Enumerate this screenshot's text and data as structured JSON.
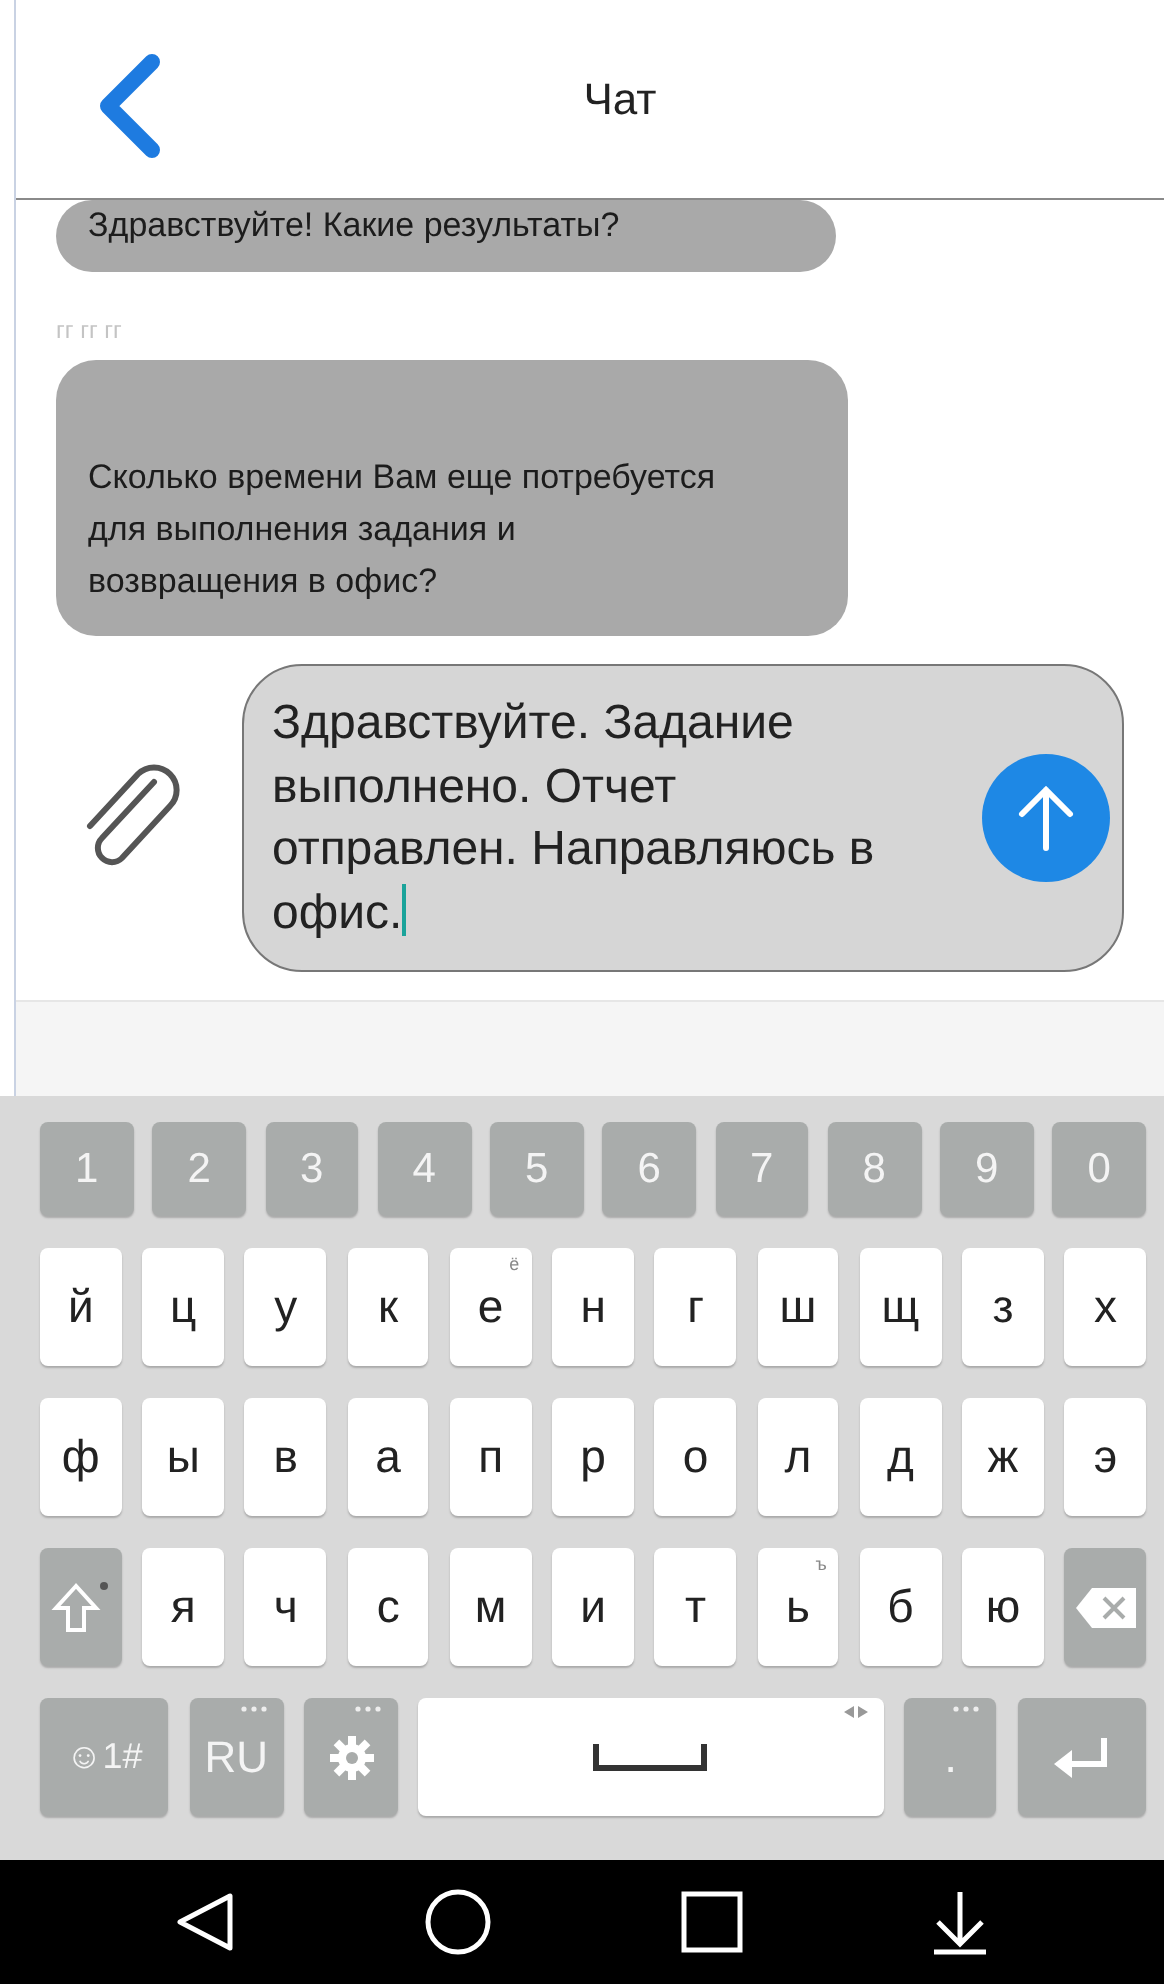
{
  "header": {
    "title": "Чат"
  },
  "messages": [
    {
      "text": "Здравствуйте! Какие результаты?"
    },
    {
      "time": "гг гг гг",
      "text": "Сколько времени Вам еще потребуется для выполнения задания и возвращения в офис?"
    }
  ],
  "compose": {
    "value": "Здравствуйте. Задание выполнено. Отчет отправлен. Направляюсь в офис.",
    "focused": true
  },
  "keyboard": {
    "number_keys": [
      "1",
      "2",
      "3",
      "4",
      "5",
      "6",
      "7",
      "8",
      "9",
      "0"
    ],
    "rows": [
      [
        {
          "kind": "letter",
          "label": "й"
        },
        {
          "kind": "letter",
          "label": "ц"
        },
        {
          "kind": "letter",
          "label": "у"
        },
        {
          "kind": "letter",
          "label": "к"
        },
        {
          "kind": "letter",
          "label": "е",
          "hint": "ё"
        },
        {
          "kind": "letter",
          "label": "н"
        },
        {
          "kind": "letter",
          "label": "г"
        },
        {
          "kind": "letter",
          "label": "ш"
        },
        {
          "kind": "letter",
          "label": "щ"
        },
        {
          "kind": "letter",
          "label": "з"
        },
        {
          "kind": "letter",
          "label": "х"
        }
      ],
      [
        {
          "kind": "letter",
          "label": "ф"
        },
        {
          "kind": "letter",
          "label": "ы"
        },
        {
          "kind": "letter",
          "label": "в"
        },
        {
          "kind": "letter",
          "label": "а"
        },
        {
          "kind": "letter",
          "label": "п"
        },
        {
          "kind": "letter",
          "label": "р"
        },
        {
          "kind": "letter",
          "label": "о"
        },
        {
          "kind": "letter",
          "label": "л"
        },
        {
          "kind": "letter",
          "label": "д"
        },
        {
          "kind": "letter",
          "label": "ж"
        },
        {
          "kind": "letter",
          "label": "э"
        }
      ],
      [
        {
          "kind": "shift"
        },
        {
          "kind": "letter",
          "label": "я"
        },
        {
          "kind": "letter",
          "label": "ч"
        },
        {
          "kind": "letter",
          "label": "с"
        },
        {
          "kind": "letter",
          "label": "м"
        },
        {
          "kind": "letter",
          "label": "и"
        },
        {
          "kind": "letter",
          "label": "т"
        },
        {
          "kind": "letter",
          "label": "ь",
          "hint": "ъ"
        },
        {
          "kind": "letter",
          "label": "б"
        },
        {
          "kind": "letter",
          "label": "ю"
        },
        {
          "kind": "backspace"
        }
      ],
      [
        {
          "kind": "symbols",
          "label": "☺1#"
        },
        {
          "kind": "lang",
          "label": "RU"
        },
        {
          "kind": "settings"
        },
        {
          "kind": "space"
        },
        {
          "kind": "period",
          "label": "."
        },
        {
          "kind": "enter"
        }
      ]
    ]
  }
}
